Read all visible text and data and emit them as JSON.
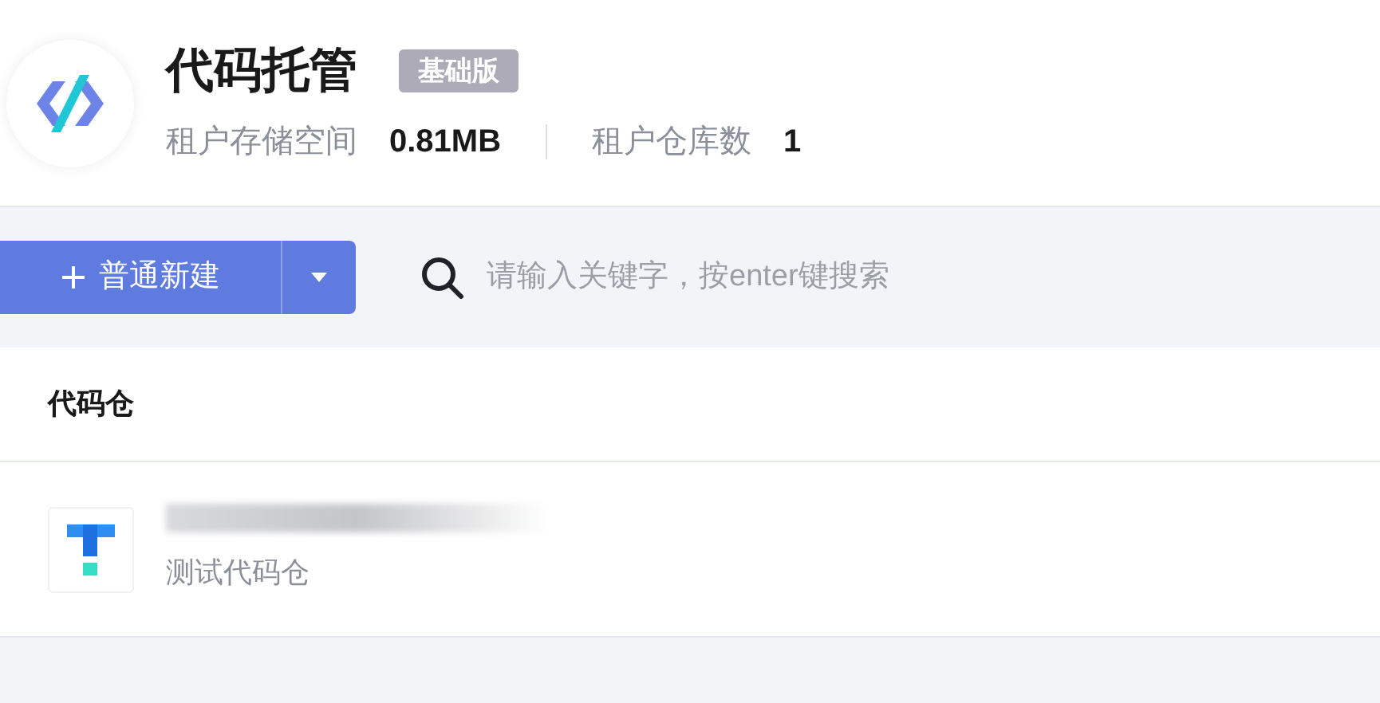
{
  "header": {
    "title": "代码托管",
    "badge": "基础版",
    "stats": [
      {
        "label": "租户存储空间",
        "value": "0.81MB"
      },
      {
        "label": "租户仓库数",
        "value": "1"
      }
    ]
  },
  "toolbar": {
    "new_button": "普通新建",
    "search": {
      "placeholder": "请输入关键字，按enter键搜索"
    }
  },
  "table": {
    "columns": [
      "代码仓"
    ],
    "rows": [
      {
        "description": "测试代码仓"
      }
    ]
  }
}
